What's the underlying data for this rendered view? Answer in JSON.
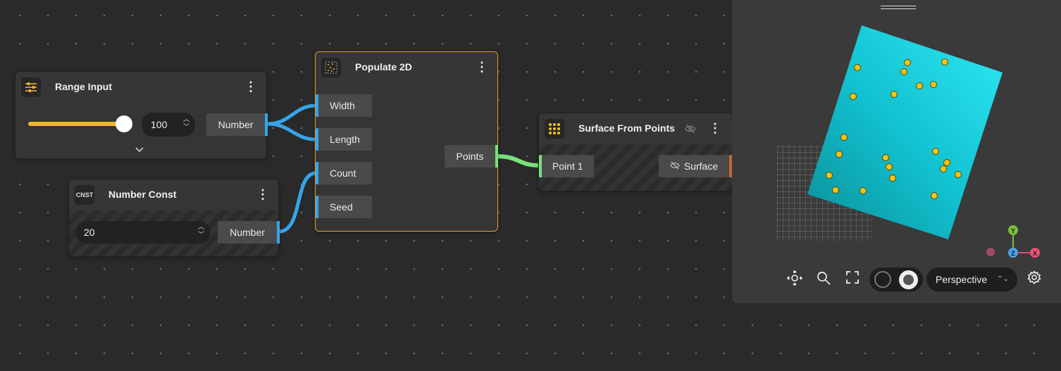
{
  "nodes": {
    "range_input": {
      "title": "Range Input",
      "icon": "sliders-icon",
      "value": "100",
      "slider_fraction": 0.97,
      "output_label": "Number"
    },
    "number_const": {
      "title": "Number Const",
      "icon_text": "CNST",
      "value": "20",
      "output_label": "Number"
    },
    "populate_2d": {
      "title": "Populate 2D",
      "icon": "scatter-points-icon",
      "inputs": [
        "Width",
        "Length",
        "Count",
        "Seed"
      ],
      "output_label": "Points"
    },
    "surface_from_points": {
      "title": "Surface From Points",
      "icon": "grid-dots-icon",
      "hidden_icon": "eye-off-icon",
      "input_label": "Point 1",
      "output_label": "Surface"
    }
  },
  "viewport": {
    "camera_mode": "Perspective",
    "axes": [
      "Y",
      "Z",
      "X"
    ],
    "controls": [
      "orbit-icon",
      "zoom-fit-icon",
      "fullscreen-icon",
      "wireframe-toggle",
      "shaded-toggle",
      "settings-icon"
    ]
  },
  "colors": {
    "canvas_bg": "#2a2a2a",
    "number_wire": "#35a5ea",
    "points_wire": "#7be07b",
    "slider_accent": "#f2b531",
    "selected_border": "#e0a030",
    "surface_cyan": "#10c8d8",
    "point_yellow": "#f5c518"
  }
}
